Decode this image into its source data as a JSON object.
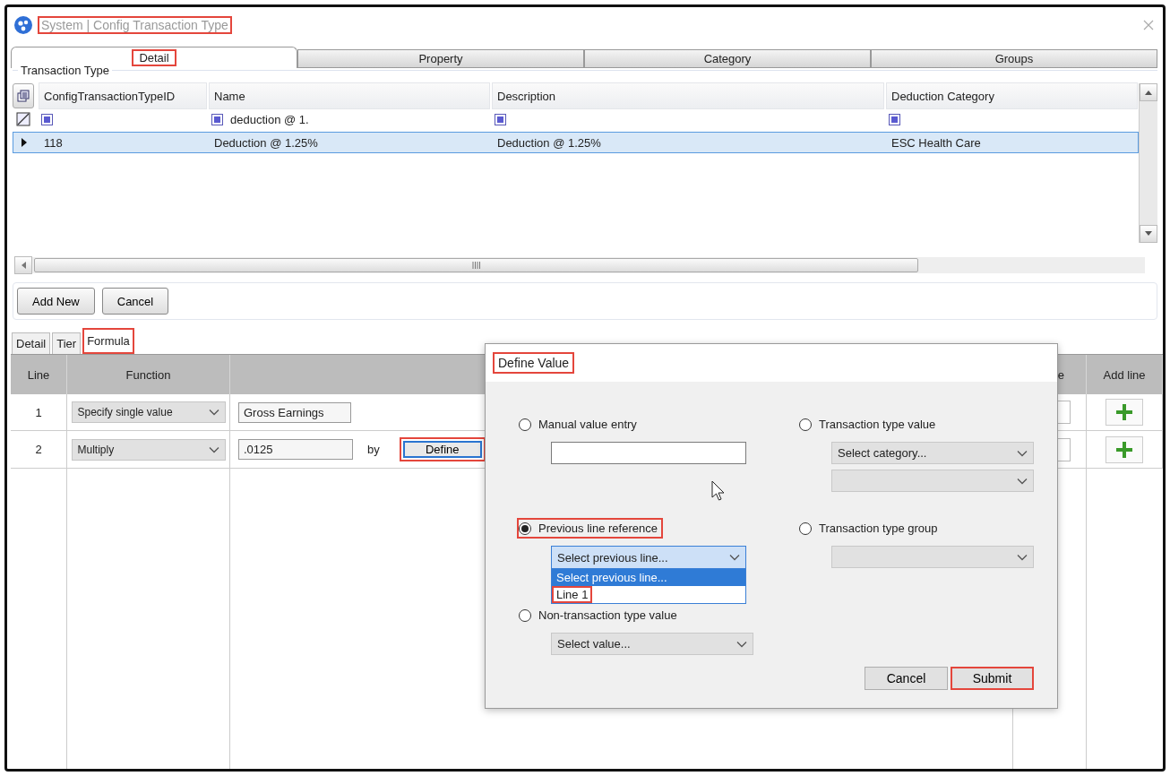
{
  "window": {
    "title": "System | Config Transaction Type",
    "highlighted": true
  },
  "tabs": [
    {
      "label": "Detail",
      "selected": true,
      "highlighted": true
    },
    {
      "label": "Property",
      "selected": false,
      "highlighted": false
    },
    {
      "label": "Category",
      "selected": false,
      "highlighted": false
    },
    {
      "label": "Groups",
      "selected": false,
      "highlighted": false
    }
  ],
  "transaction_type": {
    "legend": "Transaction Type",
    "columns": [
      "ConfigTransactionTypeID",
      "Name",
      "Description",
      "Deduction Category"
    ],
    "filter_row": [
      {
        "kind": "blank"
      },
      {
        "kind": "text",
        "value": "deduction @ 1."
      },
      {
        "kind": "blank"
      },
      {
        "kind": "blank"
      }
    ],
    "rows": [
      {
        "selected": true,
        "cells": [
          "118",
          "Deduction @ 1.25%",
          "Deduction @ 1.25%",
          "ESC Health Care"
        ]
      }
    ]
  },
  "buttons": [
    {
      "label": "Add New"
    },
    {
      "label": "Cancel"
    }
  ],
  "sub_tabs": [
    {
      "label": "Detail",
      "selected": false,
      "highlighted": false
    },
    {
      "label": "Tier",
      "selected": false,
      "highlighted": false
    },
    {
      "label": "Formula",
      "selected": true,
      "highlighted": true
    }
  ],
  "formula": {
    "columns": [
      "Line",
      "Function"
    ],
    "column_4": "e",
    "add_line_header": "Add line",
    "rows": [
      {
        "line": "1",
        "function": "Specify single value",
        "value": "Gross Earnings"
      },
      {
        "line": "2",
        "function": "Multiply",
        "value": ".0125",
        "by": "by",
        "define": {
          "label": "Define",
          "highlighted": true
        }
      }
    ]
  },
  "dialog": {
    "title": "Define Value",
    "title_highlighted": true,
    "options": [
      {
        "label": "Manual value entry",
        "selected": false,
        "highlighted": false,
        "controls": [
          {
            "kind": "input"
          }
        ]
      },
      {
        "label": "Transaction type value",
        "selected": false,
        "highlighted": false,
        "controls": [
          {
            "kind": "select",
            "value": "Select category..."
          },
          {
            "kind": "select"
          }
        ]
      },
      {
        "label": "Previous line reference",
        "selected": true,
        "highlighted": true,
        "controls": [
          {
            "kind": "open_select",
            "value": "Select previous line...",
            "items": [
              {
                "label": "Select previous line...",
                "selected": true,
                "highlighted": false
              },
              {
                "label": "Line 1",
                "selected": false,
                "highlighted": true
              }
            ]
          }
        ]
      },
      {
        "label": "Transaction type group",
        "selected": false,
        "highlighted": false,
        "controls": [
          {
            "kind": "select"
          }
        ]
      },
      {
        "label": "Non-transaction type value",
        "selected": false,
        "highlighted": false,
        "controls": [
          {
            "kind": "select",
            "value": "Select value..."
          }
        ]
      }
    ],
    "buttons": [
      {
        "label": "Cancel",
        "highlighted": false
      },
      {
        "label": "Submit",
        "highlighted": true
      }
    ]
  }
}
